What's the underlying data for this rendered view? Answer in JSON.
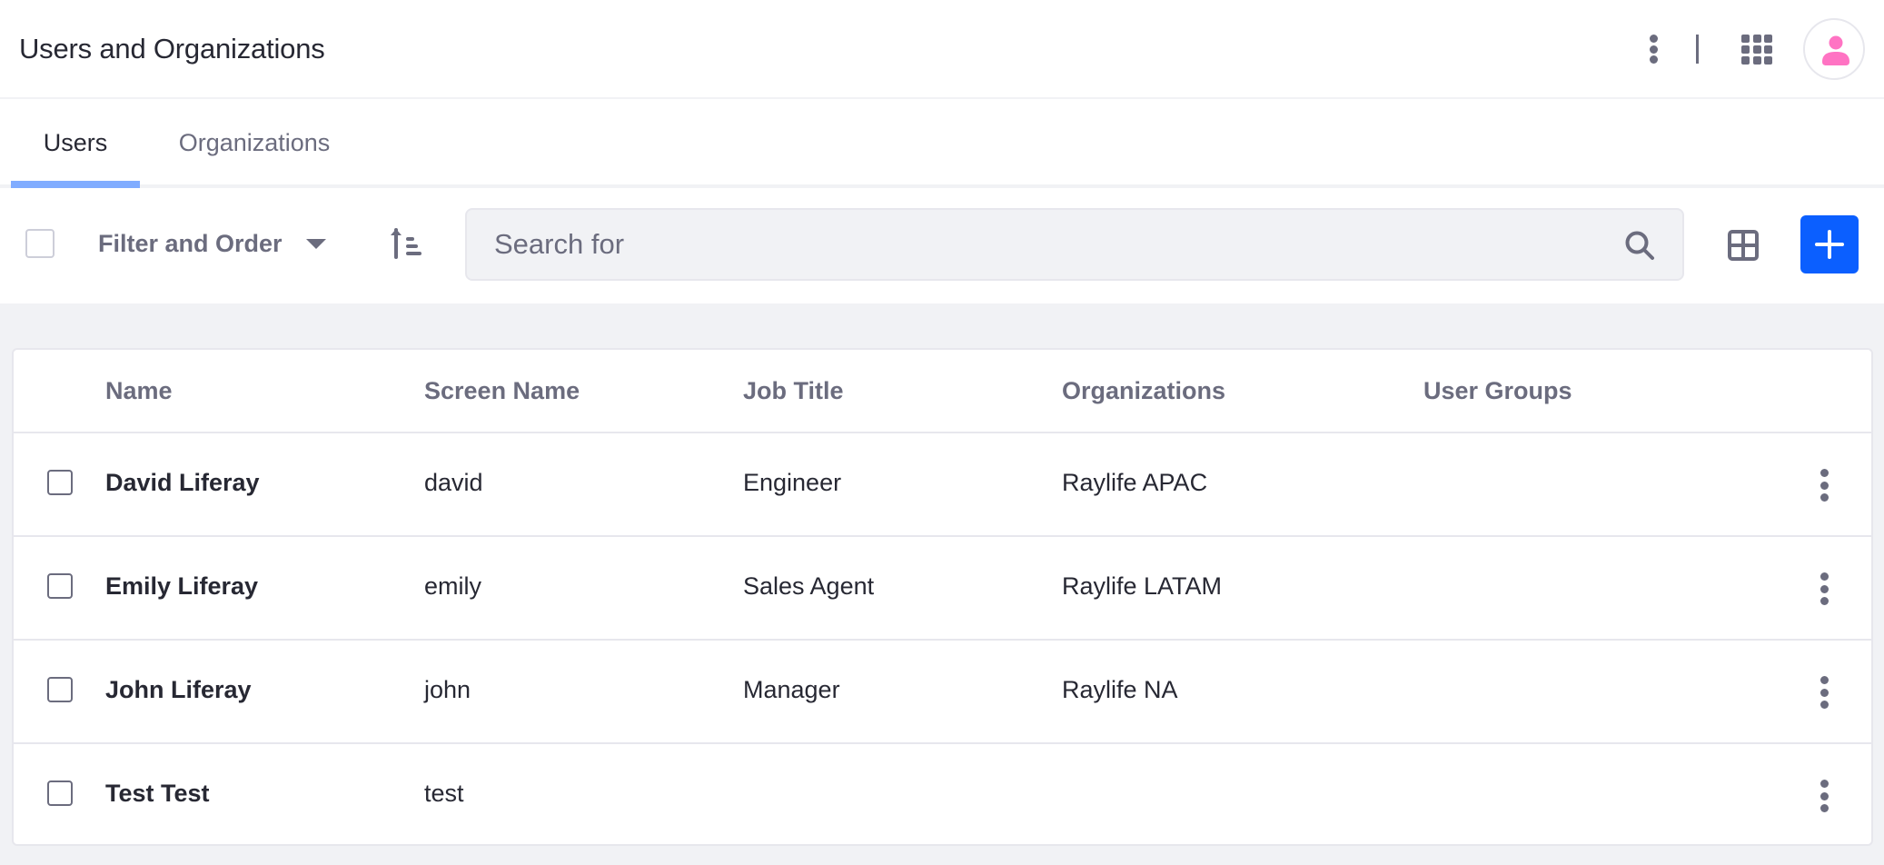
{
  "header": {
    "title": "Users and Organizations",
    "icons": {
      "options": "kebab-vertical-icon",
      "apps": "grid-apps-icon",
      "user": "user-avatar-icon"
    },
    "avatar_color": "#ff73c3"
  },
  "tabs": [
    {
      "label": "Users",
      "active": true
    },
    {
      "label": "Organizations",
      "active": false
    }
  ],
  "toolbar": {
    "filter_label": "Filter and Order",
    "search": {
      "placeholder": "Search for",
      "value": ""
    },
    "accent_color": "#0b5fff"
  },
  "table": {
    "columns": [
      "Name",
      "Screen Name",
      "Job Title",
      "Organizations",
      "User Groups"
    ],
    "rows": [
      {
        "name": "David Liferay",
        "screen_name": "david",
        "job_title": "Engineer",
        "organizations": "Raylife APAC",
        "user_groups": ""
      },
      {
        "name": "Emily Liferay",
        "screen_name": "emily",
        "job_title": "Sales Agent",
        "organizations": "Raylife LATAM",
        "user_groups": ""
      },
      {
        "name": "John Liferay",
        "screen_name": "john",
        "job_title": "Manager",
        "organizations": "Raylife NA",
        "user_groups": ""
      },
      {
        "name": "Test Test",
        "screen_name": "test",
        "job_title": "",
        "organizations": "",
        "user_groups": ""
      }
    ]
  }
}
